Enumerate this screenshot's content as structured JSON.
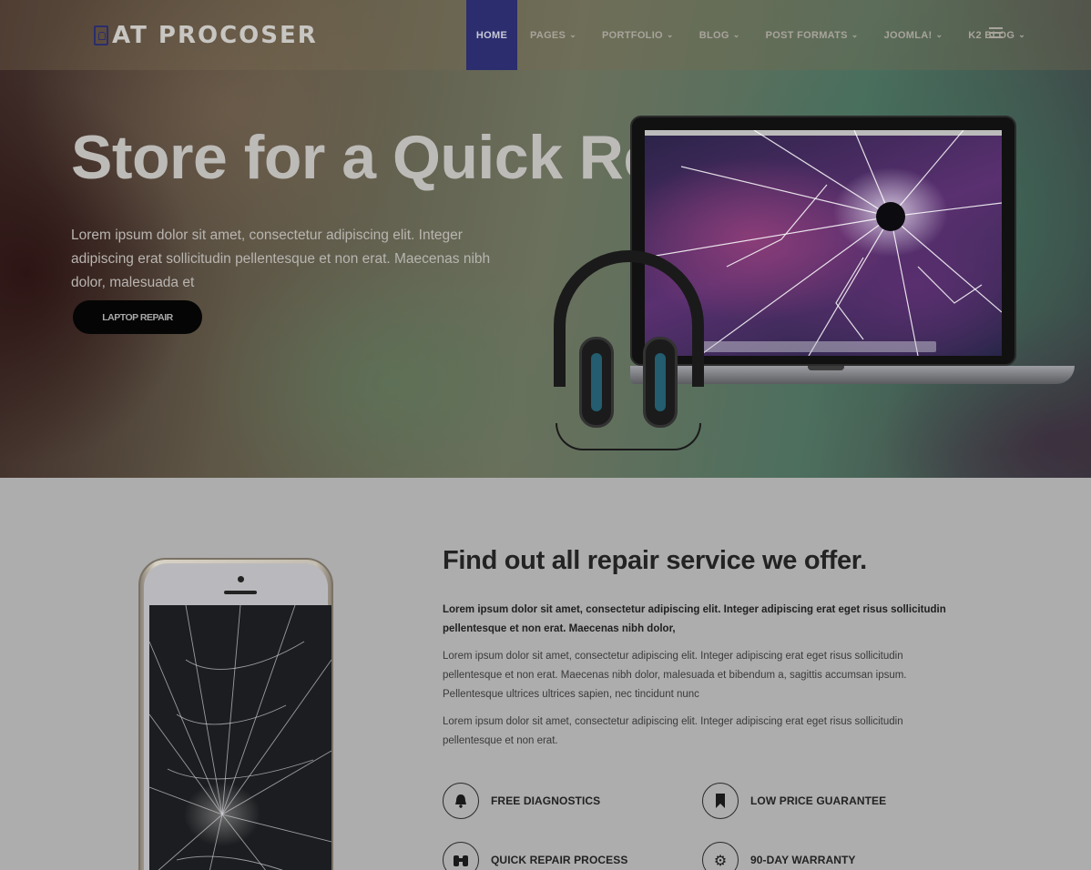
{
  "header": {
    "logo_text": "AT PROCOSER",
    "nav": [
      {
        "label": "HOME",
        "active": true,
        "dropdown": false
      },
      {
        "label": "PAGES",
        "active": false,
        "dropdown": true
      },
      {
        "label": "PORTFOLIO",
        "active": false,
        "dropdown": true
      },
      {
        "label": "BLOG",
        "active": false,
        "dropdown": true
      },
      {
        "label": "POST FORMATS",
        "active": false,
        "dropdown": true
      },
      {
        "label": "JOOMLA!",
        "active": false,
        "dropdown": true
      },
      {
        "label": "K2 BLOG",
        "active": false,
        "dropdown": true
      }
    ],
    "menu_icon": "hamburger-icon"
  },
  "hero": {
    "title": "Store for a Quick Repair",
    "description": "Lorem ipsum dolor sit amet, consectetur adipiscing elit. Integer adipiscing erat sollicitudin pellentesque et non erat. Maecenas nibh dolor, malesuada et",
    "button_label": "LAPTOP REPAIR"
  },
  "services": {
    "title": "Find out all repair service we offer.",
    "lead": "Lorem ipsum dolor sit amet, consectetur adipiscing elit. Integer adipiscing erat eget risus sollicitudin pellentesque et non erat. Maecenas nibh dolor,",
    "paragraph_1": "Lorem ipsum dolor sit amet, consectetur adipiscing elit. Integer adipiscing erat eget risus sollicitudin pellentesque et non erat. Maecenas nibh dolor, malesuada et bibendum a, sagittis accumsan ipsum. Pellentesque ultrices ultrices sapien, nec tincidunt nunc",
    "paragraph_2": "Lorem ipsum dolor sit amet, consectetur adipiscing elit. Integer adipiscing erat eget risus sollicitudin pellentesque et non erat.",
    "features": [
      {
        "label": "FREE DIAGNOSTICS",
        "icon": "bell-icon",
        "glyph": "🔔"
      },
      {
        "label": "LOW PRICE GUARANTEE",
        "icon": "bookmark-icon",
        "glyph": "🔖"
      },
      {
        "label": "QUICK REPAIR PROCESS",
        "icon": "binoculars-icon",
        "glyph": "⛟"
      },
      {
        "label": "90-DAY WARRANTY",
        "icon": "gears-icon",
        "glyph": "⚙"
      }
    ]
  },
  "colors": {
    "nav_active_bg": "#2b2d6e",
    "button_bg": "#050505",
    "content_bg": "#adadad"
  }
}
